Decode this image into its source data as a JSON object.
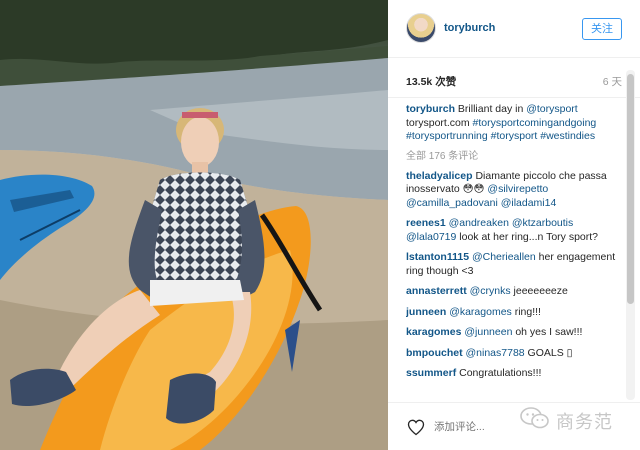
{
  "post": {
    "username": "toryburch",
    "follow_label": "关注",
    "likes": "13.5k 次赞",
    "time": "6 天"
  },
  "caption": {
    "user": "toryburch",
    "text_1": " Brilliant day in ",
    "mention": "@torysport",
    "text_2": " torysport.com ",
    "hashtags": "#torysportcomingandgoing #torysportrunning #torysport #westindies"
  },
  "view_all_comments": "全部 176 条评论",
  "comments": [
    {
      "user": "theladyalicep",
      "text": " Diamante piccolo che passa inosservato 😳😳 ",
      "mentions": "@silvirepetto @camilla_padovani @iladami14"
    },
    {
      "user": "reenes1",
      "text": " ",
      "mentions": "@andreaken @ktzarboutis @lala0719",
      "text2": " look at her ring...n Tory sport?"
    },
    {
      "user": "lstanton1115",
      "text": " ",
      "mentions": "@Cherieallen",
      "text2": " her engagement ring though <3"
    },
    {
      "user": "annasterrett",
      "text": " ",
      "mentions": "@crynks",
      "text2": " jeeeeeeeze"
    },
    {
      "user": "junneen",
      "text": " ",
      "mentions": "@karagomes",
      "text2": " ring!!!"
    },
    {
      "user": "karagomes",
      "text": " ",
      "mentions": "@junneen",
      "text2": " oh yes I saw!!!"
    },
    {
      "user": "bmpouchet",
      "text": " ",
      "mentions": "@ninas7788",
      "text2": " GOALS ▯"
    },
    {
      "user": "ssummerf",
      "text": " Congratulations!!!",
      "mentions": "",
      "text2": ""
    }
  ],
  "footer": {
    "comment_placeholder": "添加评论..."
  },
  "watermark": {
    "text": "商务范"
  },
  "icons": {
    "like": "heart-icon",
    "watermark_logo": "wechat-logo-icon"
  }
}
